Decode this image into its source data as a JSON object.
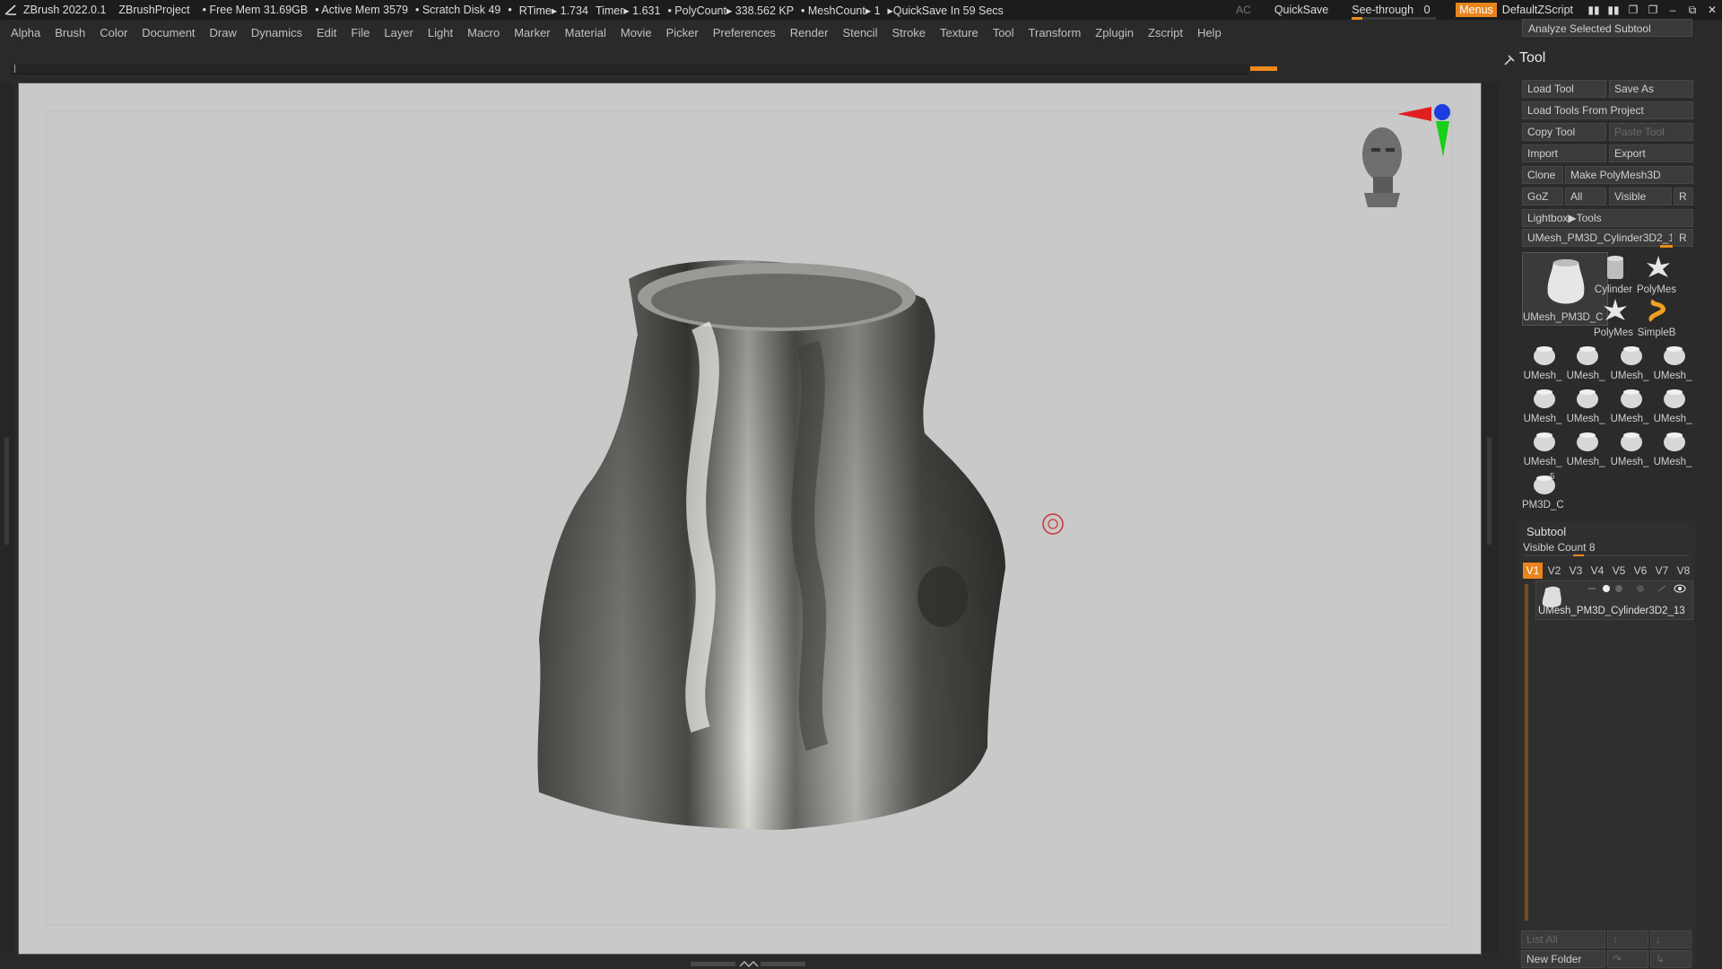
{
  "titlebar": {
    "app": "ZBrush 2022.0.1",
    "project": "ZBrushProject",
    "free_mem": "• Free Mem 31.69GB",
    "active_mem": "• Active Mem 3579",
    "scratch": "• Scratch Disk 49",
    "bullet": "•",
    "rtime": "RTime▸ 1.734",
    "timer": "Timer▸ 1.631",
    "polycount": "• PolyCount▸ 338.562 KP",
    "meshcount": "• MeshCount▸ 1",
    "quicksave_in": "▸QuickSave In 59 Secs",
    "ac": "AC",
    "quicksave": "QuickSave",
    "see_through": "See-through",
    "see_through_val": "0",
    "menus": "Menus",
    "script": "DefaultZScript"
  },
  "menubar": [
    "Alpha",
    "Brush",
    "Color",
    "Document",
    "Draw",
    "Dynamics",
    "Edit",
    "File",
    "Layer",
    "Light",
    "Macro",
    "Marker",
    "Material",
    "Movie",
    "Picker",
    "Preferences",
    "Render",
    "Stencil",
    "Stroke",
    "Texture",
    "Tool",
    "Transform",
    "Zplugin",
    "Zscript",
    "Help"
  ],
  "analyze": "Analyze Selected Subtool",
  "tool_panel": {
    "title": "Tool",
    "load_tool": "Load Tool",
    "save_as": "Save As",
    "load_from_project": "Load Tools From Project",
    "copy_tool": "Copy Tool",
    "paste_tool": "Paste Tool",
    "import": "Import",
    "export": "Export",
    "clone": "Clone",
    "make_polymesh": "Make PolyMesh3D",
    "goz": "GoZ",
    "all": "All",
    "visible": "Visible",
    "r": "R",
    "lightbox": "Lightbox▶Tools",
    "current_tool": "UMesh_PM3D_Cylinder3D2_1",
    "current_r": "R",
    "big_thumb_label": "UMesh_PM3D_C",
    "big_count": "",
    "thumbs": [
      {
        "label": "Cylinder",
        "icon": "cylinder"
      },
      {
        "label": "PolyMes",
        "icon": "star"
      },
      {
        "label": "PolyMes",
        "icon": "star"
      },
      {
        "label": "SimpleB",
        "icon": "snake"
      },
      {
        "label": "UMesh_",
        "icon": "mesh"
      },
      {
        "label": "UMesh_",
        "icon": "mesh"
      },
      {
        "label": "UMesh_",
        "icon": "mesh"
      },
      {
        "label": "UMesh_",
        "icon": "mesh"
      },
      {
        "label": "UMesh_",
        "icon": "mesh"
      },
      {
        "label": "UMesh_",
        "icon": "mesh"
      },
      {
        "label": "UMesh_",
        "icon": "mesh"
      },
      {
        "label": "UMesh_",
        "icon": "mesh"
      },
      {
        "label": "UMesh_",
        "icon": "mesh"
      },
      {
        "label": "UMesh_",
        "icon": "mesh"
      },
      {
        "label": "UMesh_",
        "icon": "mesh"
      },
      {
        "label": "UMesh_",
        "icon": "mesh"
      },
      {
        "label": "PM3D_C",
        "icon": "mesh"
      }
    ],
    "pm3d_count": "5"
  },
  "subtool": {
    "title": "Subtool",
    "visible_count": "Visible Count 8",
    "tabs": [
      "V1",
      "V2",
      "V3",
      "V4",
      "V5",
      "V6",
      "V7",
      "V8"
    ],
    "active_tab": "V1",
    "item_name": "UMesh_PM3D_Cylinder3D2_13",
    "list_all": "List All",
    "new_folder": "New Folder"
  }
}
